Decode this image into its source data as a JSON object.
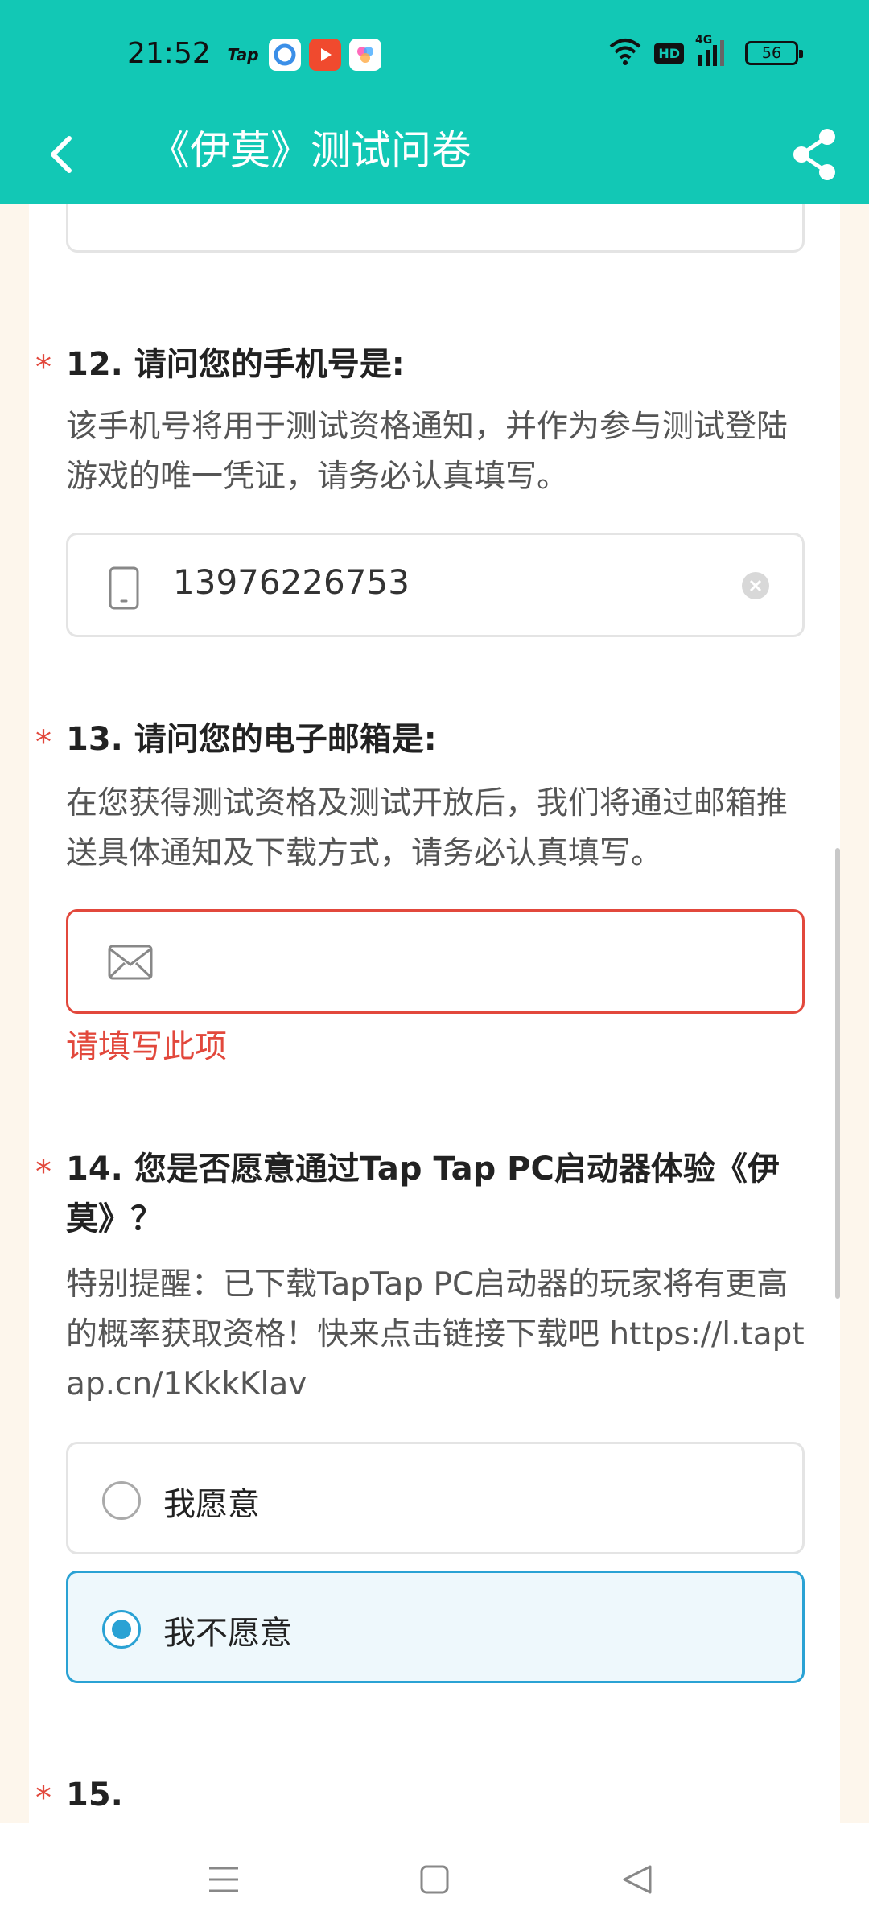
{
  "status_bar": {
    "time": "21:52",
    "app_icons": [
      "Tap",
      "browser",
      "video",
      "gallery"
    ],
    "network": "4G",
    "hd": "HD",
    "battery": "56"
  },
  "header": {
    "title": "《伊莫》测试问卷",
    "back_icon": "chevron-left-icon",
    "share_icon": "share-icon"
  },
  "questions": {
    "q12": {
      "title": "12. 请问您的手机号是:",
      "description": "该手机号将用于测试资格通知，并作为参与测试登陆游戏的唯一凭证，请务必认真填写。",
      "value": "13976226753"
    },
    "q13": {
      "title": "13. 请问您的电子邮箱是:",
      "description": "在您获得测试资格及测试开放后，我们将通过邮箱推送具体通知及下载方式，请务必认真填写。",
      "value": "",
      "error": "请填写此项"
    },
    "q14": {
      "title": "14. 您是否愿意通过Tap Tap PC启动器体验《伊莫》？",
      "description": "特别提醒：已下载TapTap PC启动器的玩家将有更高的概率获取资格！快来点击链接下载吧 https://l.taptap.cn/1KkkKlav",
      "options": [
        {
          "label": "我愿意",
          "selected": false
        },
        {
          "label": "我不愿意",
          "selected": true
        }
      ]
    },
    "q15": {
      "title": "15."
    }
  },
  "required_marker": "*",
  "colors": {
    "header": "#12c8b5",
    "required": "#e2483c",
    "selected": "#2aa2d4",
    "page_background": "#fdf6ec"
  }
}
